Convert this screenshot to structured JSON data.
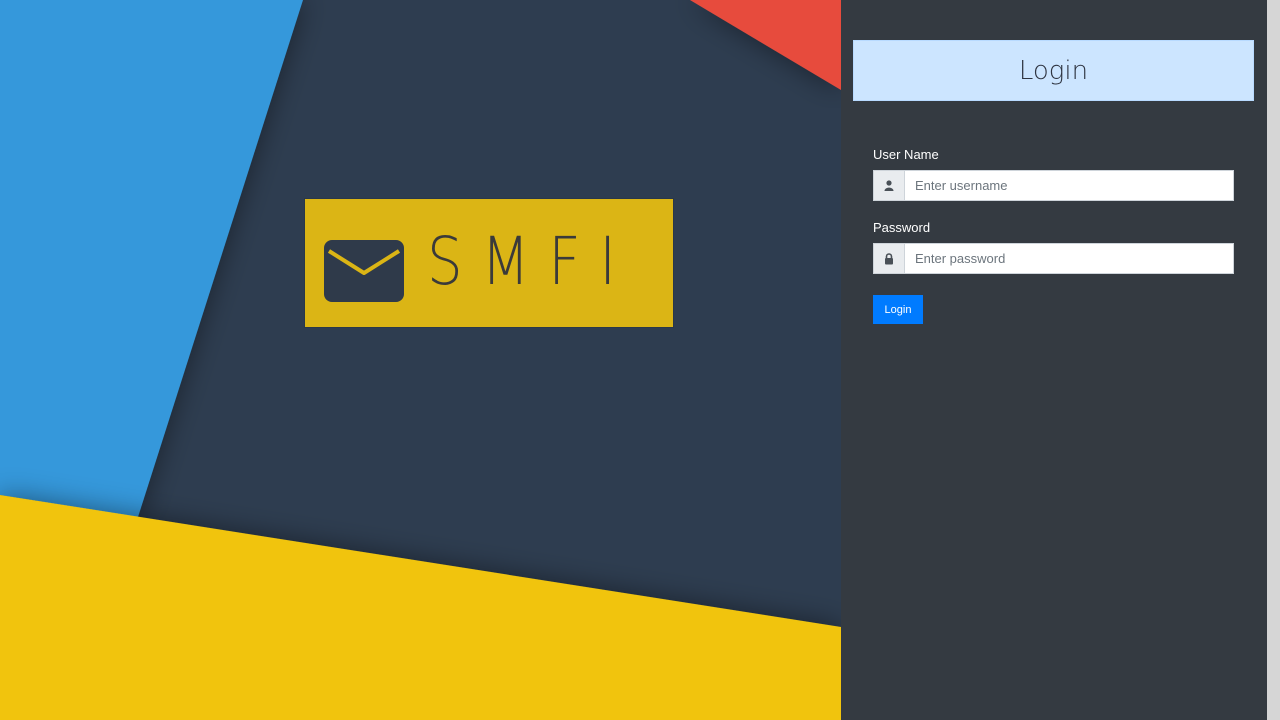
{
  "logo": {
    "text": "SMFI",
    "icon": "envelope-icon",
    "background": "#dbb515"
  },
  "background": {
    "colors": {
      "navy": "#2e3d50",
      "blue": "#3498db",
      "yellow": "#f1c40f",
      "red": "#e74c3c"
    }
  },
  "login": {
    "title": "Login",
    "username": {
      "label": "User Name",
      "placeholder": "Enter username",
      "value": "",
      "icon": "user-icon"
    },
    "password": {
      "label": "Password",
      "placeholder": "Enter password",
      "value": "",
      "icon": "lock-icon"
    },
    "submit_label": "Login",
    "accent": "#007bff",
    "header_bg": "#cce5ff",
    "panel_bg": "#343a41"
  }
}
